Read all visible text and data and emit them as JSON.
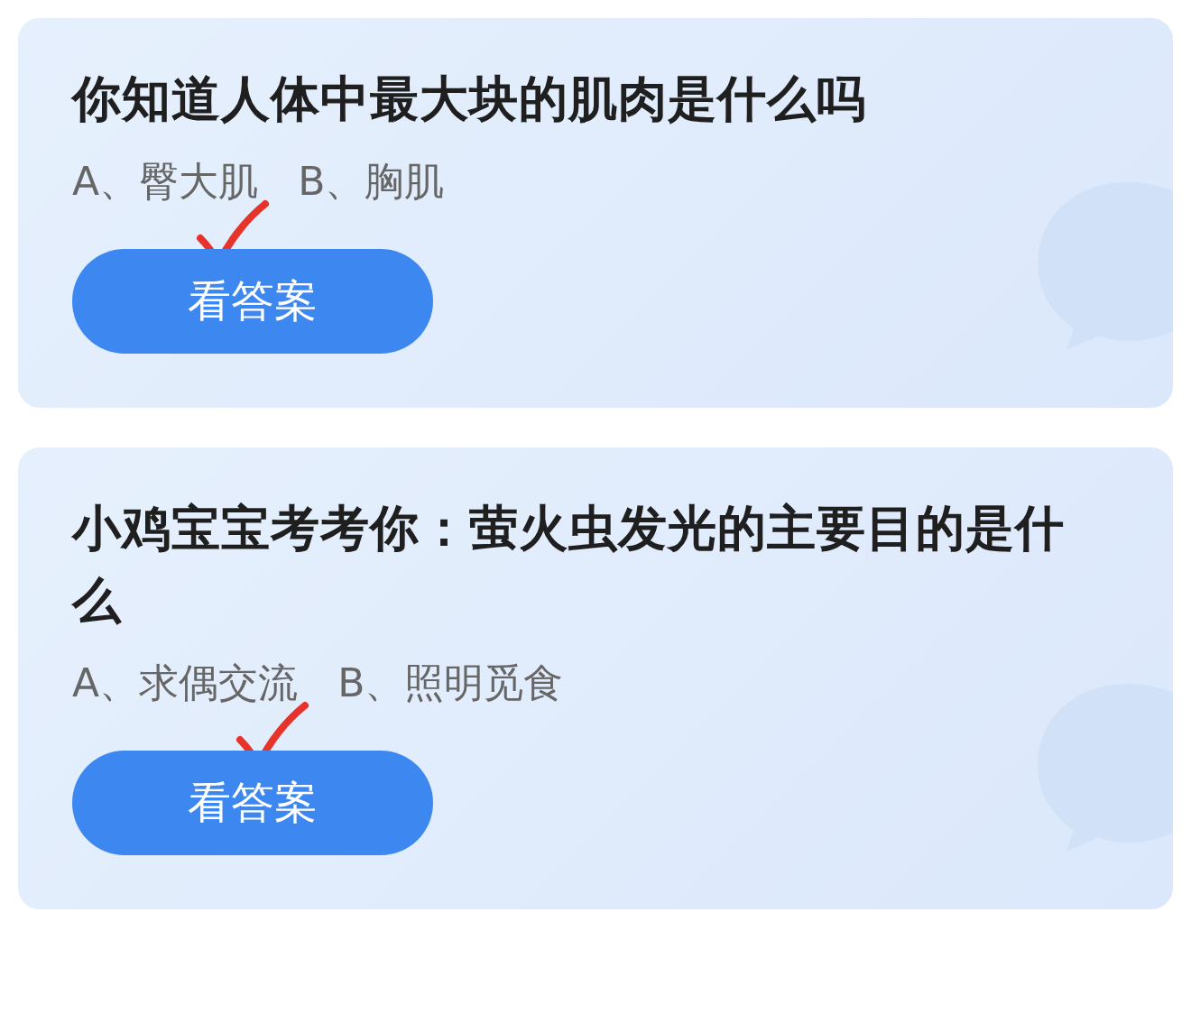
{
  "questions": [
    {
      "title": "你知道人体中最大块的肌肉是什么吗",
      "options": [
        {
          "label": "A、臀大肌",
          "checked": true
        },
        {
          "label": "B、胸肌",
          "checked": false
        }
      ],
      "button": "看答案"
    },
    {
      "title": "小鸡宝宝考考你：萤火虫发光的主要目的是什么",
      "options": [
        {
          "label": "A、求偶交流",
          "checked": true
        },
        {
          "label": "B、照明觅食",
          "checked": false
        }
      ],
      "button": "看答案"
    }
  ]
}
